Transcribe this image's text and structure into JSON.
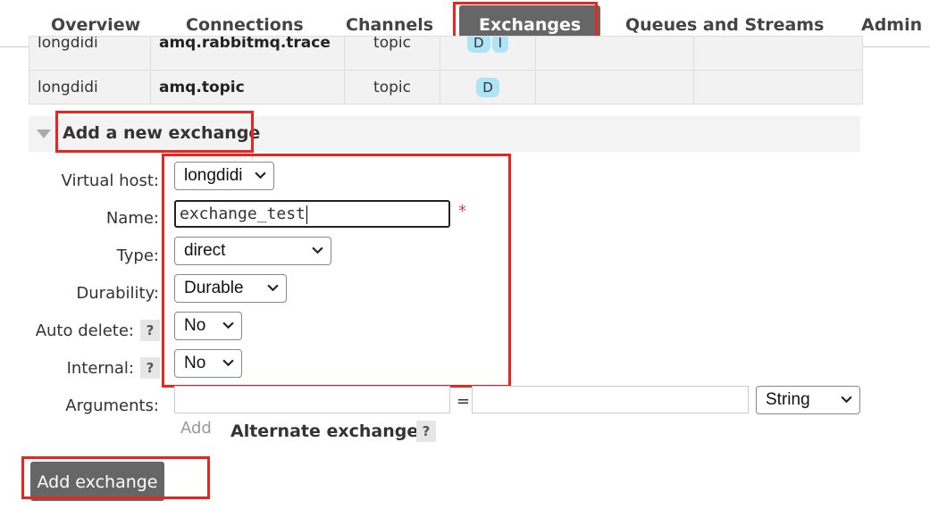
{
  "nav": {
    "tabs": [
      {
        "label": "Overview"
      },
      {
        "label": "Connections"
      },
      {
        "label": "Channels"
      },
      {
        "label": "Exchanges",
        "active": true
      },
      {
        "label": "Queues and Streams"
      },
      {
        "label": "Admin"
      }
    ]
  },
  "exchanges_table": {
    "rows": [
      {
        "vhost": "longdidi",
        "name": "amq.rabbitmq.trace",
        "type": "topic",
        "features": [
          "D",
          "I"
        ]
      },
      {
        "vhost": "longdidi",
        "name": "amq.topic",
        "type": "topic",
        "features": [
          "D"
        ]
      }
    ]
  },
  "add_exchange": {
    "section_title": "Add a new exchange",
    "virtual_host": {
      "label": "Virtual host:",
      "value": "longdidi"
    },
    "name": {
      "label": "Name:",
      "value": "exchange_test",
      "required_mark": "*"
    },
    "type": {
      "label": "Type:",
      "value": "direct"
    },
    "durability": {
      "label": "Durability:",
      "value": "Durable"
    },
    "auto_delete": {
      "label": "Auto delete:",
      "value": "No",
      "help": "?"
    },
    "internal": {
      "label": "Internal:",
      "value": "No",
      "help": "?"
    },
    "arguments": {
      "label": "Arguments:",
      "key": "",
      "equals": "=",
      "value": "",
      "value_type": "String"
    },
    "add_link": "Add",
    "alternate_exchange": {
      "label": "Alternate exchange",
      "help": "?"
    },
    "submit_label": "Add exchange"
  },
  "colors": {
    "highlight": "#e8251e",
    "active_tab": "#666666",
    "badge": "#aee4f5"
  }
}
